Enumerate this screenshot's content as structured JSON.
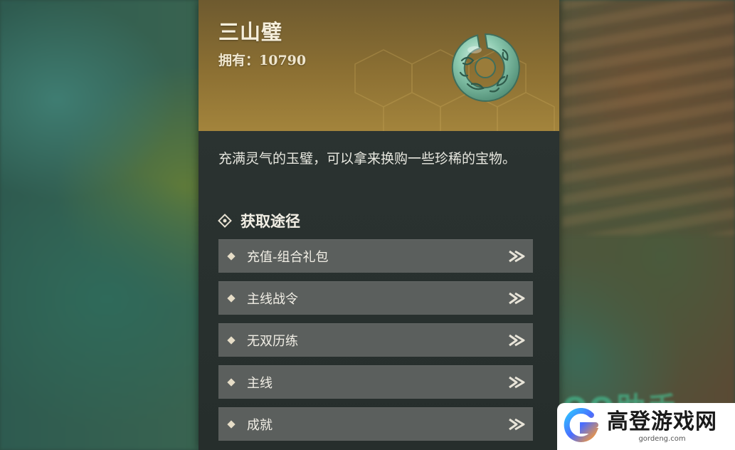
{
  "item": {
    "name": "三山璧",
    "owned_label": "拥有：10790",
    "description": "充满灵气的玉璧，可以拿来换购一些珍稀的宝物。",
    "icon": "jade-disc-icon"
  },
  "acquisition": {
    "title": "获取途径",
    "sources": [
      {
        "label": "充值-组合礼包"
      },
      {
        "label": "主线战令"
      },
      {
        "label": "无双历练"
      },
      {
        "label": "主线"
      },
      {
        "label": "成就"
      }
    ]
  },
  "watermark": {
    "name": "高登游戏网",
    "url": "gordeng.com"
  },
  "colors": {
    "header_gold": "#8c7033",
    "panel_dark": "#2a3230",
    "row_gray": "#5b5f5d",
    "jade_green": "#7fc2a8"
  }
}
